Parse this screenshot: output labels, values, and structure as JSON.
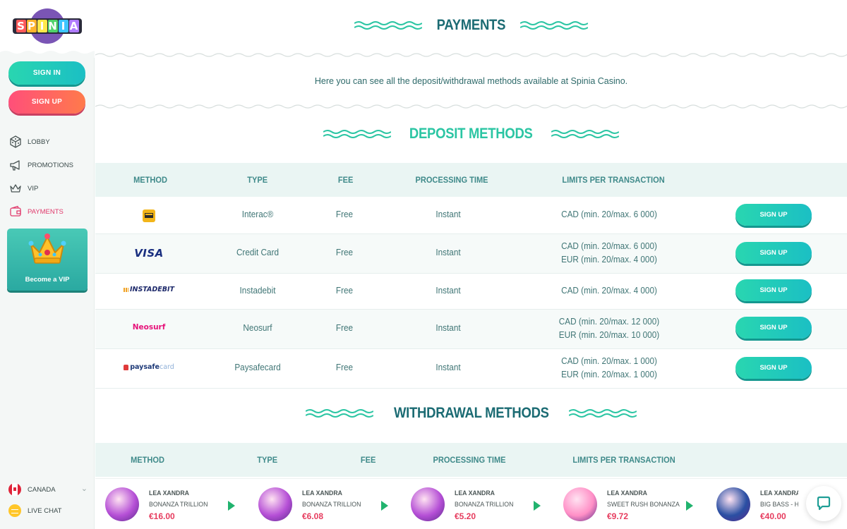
{
  "brand": {
    "logo_letters": [
      "S",
      "P",
      "I",
      "N",
      "I",
      "A"
    ],
    "logo_colors": [
      "#ff5a5a",
      "#ffb42d",
      "#ffe94a",
      "#4fd36a",
      "#3ec6ff",
      "#b07cff"
    ]
  },
  "sidebar": {
    "sign_in": "SIGN IN",
    "sign_up": "SIGN UP",
    "items": [
      {
        "label": "LOBBY",
        "icon": "dice-icon"
      },
      {
        "label": "PROMOTIONS",
        "icon": "megaphone-icon"
      },
      {
        "label": "VIP",
        "icon": "crown-icon"
      },
      {
        "label": "PAYMENTS",
        "icon": "wallet-icon"
      }
    ],
    "vip_card": "Become a VIP",
    "country": "CANADA",
    "live_chat": "LIVE CHAT"
  },
  "page": {
    "title": "PAYMENTS",
    "intro": "Here you can see all the deposit/withdrawal methods available at Spinia Casino."
  },
  "deposit": {
    "title": "DEPOSIT METHODS",
    "columns": [
      "METHOD",
      "TYPE",
      "FEE",
      "PROCESSING TIME",
      "LIMITS PER TRANSACTION"
    ],
    "rows": [
      {
        "method": "interac",
        "type": "Interac®",
        "fee": "Free",
        "time": "Instant",
        "limit1": "CAD (min. 20/max. 6 000)",
        "limit2": "",
        "button": "SIGN UP"
      },
      {
        "method": "visa",
        "type": "Credit Card",
        "fee": "Free",
        "time": "Instant",
        "limit1": "CAD (min. 20/max. 6 000)",
        "limit2": "EUR (min. 20/max. 4 000)",
        "button": "SIGN UP"
      },
      {
        "method": "instadebit",
        "type": "Instadebit",
        "fee": "Free",
        "time": "Instant",
        "limit1": "CAD (min. 20/max. 4 000)",
        "limit2": "",
        "button": "SIGN UP"
      },
      {
        "method": "neosurf",
        "type": "Neosurf",
        "fee": "Free",
        "time": "Instant",
        "limit1": "CAD (min. 20/max. 12 000)",
        "limit2": "EUR (min. 20/max. 10 000)",
        "button": "SIGN UP"
      },
      {
        "method": "paysafecard",
        "type": "Paysafecard",
        "fee": "Free",
        "time": "Instant",
        "limit1": "CAD (min. 20/max. 1 000)",
        "limit2": "EUR (min. 20/max. 1 000)",
        "button": "SIGN UP"
      }
    ],
    "logos": {
      "visa": "VISA",
      "instadebit": "INSTADEBIT",
      "neosurf": "Neosurf",
      "paysafecard_a": "paysafe",
      "paysafecard_b": "card"
    }
  },
  "withdrawal": {
    "title": "WITHDRAWAL METHODS",
    "columns": [
      "METHOD",
      "TYPE",
      "FEE",
      "PROCESSING TIME",
      "LIMITS PER TRANSACTION"
    ]
  },
  "ticker": [
    {
      "name": "LEA XANDRA",
      "game": "BONANZA TRILLION",
      "amount": "€16.00",
      "thumb_color": "#b54fd6"
    },
    {
      "name": "LEA XANDRA",
      "game": "BONANZA TRILLION",
      "amount": "€6.08",
      "thumb_color": "#b54fd6"
    },
    {
      "name": "LEA XANDRA",
      "game": "BONANZA TRILLION",
      "amount": "€5.20",
      "thumb_color": "#b54fd6"
    },
    {
      "name": "LEA XANDRA",
      "game": "SWEET RUSH BONANZA",
      "amount": "€9.72",
      "thumb_color": "#ff8fc6"
    },
    {
      "name": "LEA XANDRA",
      "game": "BIG BASS - HOL",
      "amount": "€40.00",
      "thumb_color": "#2a4fa3"
    }
  ],
  "colors": {
    "teal": "#2bc5a3",
    "dark_teal": "#1b6b73",
    "pink": "#e03a6c",
    "amount_red": "#e63c5e"
  }
}
